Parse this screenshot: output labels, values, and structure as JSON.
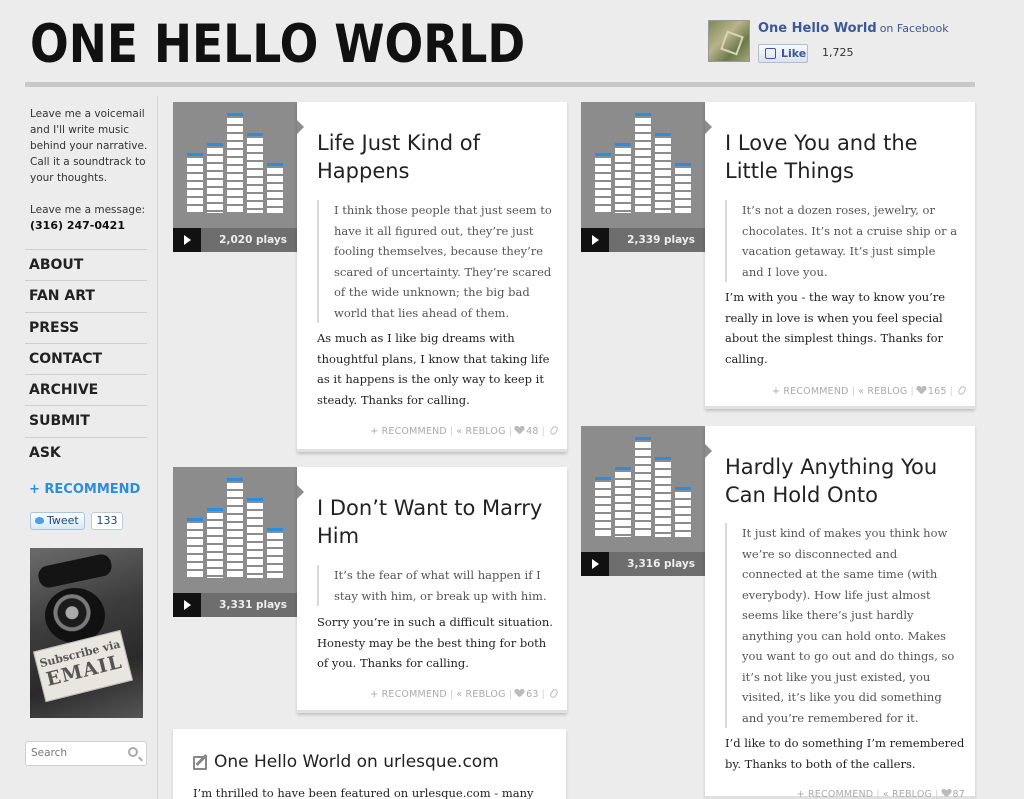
{
  "site": {
    "title": "ONE HELLO WORLD"
  },
  "facebook": {
    "page_name": "One Hello World",
    "on_text": "on Facebook",
    "like_label": "Like",
    "like_count": "1,725"
  },
  "sidebar": {
    "intro": "Leave me a voicemail and I'll write music behind your narrative. Call it a soundtrack to your thoughts.",
    "message_label": "Leave me a message:",
    "phone": "(316) 247-0421",
    "nav": [
      "About",
      "Fan Art",
      "Press",
      "Contact",
      "Archive",
      "Submit",
      "Ask"
    ],
    "recommend_label": "+ RECOMMEND",
    "tweet_label": "Tweet",
    "tweet_count": "133",
    "subscribe_line1": "Subscribe via",
    "subscribe_line2": "EMAIL",
    "search_placeholder": "Search"
  },
  "posts": [
    {
      "title": "Life Just Kind of Happens",
      "plays": "2,020 plays",
      "quote": "I think those people that just seem to have it all figured out, they’re just fooling themselves, because they’re scared of uncertainty. They’re scared of the wide unknown; the big bad world that lies ahead of them.",
      "body": "As much as I like big dreams with thoughtful plans, I know that taking life as it happens is the only way to keep it steady. Thanks for calling.",
      "recommend": "+ RECOMMEND",
      "reblog": "« REBLOG",
      "likes": "48"
    },
    {
      "title": "I Love You and the Little Things",
      "plays": "2,339 plays",
      "quote": "It’s not a dozen roses, jewelry, or chocolates. It’s not a cruise ship or a vacation getaway. It’s just simple and I love you.",
      "body": "I’m with you - the way to know you’re really in love is when you feel special about the simplest things. Thanks for calling.",
      "recommend": "+ RECOMMEND",
      "reblog": "« REBLOG",
      "likes": "165"
    },
    {
      "title": "I Don’t Want to Marry Him",
      "plays": "3,331 plays",
      "quote": "It’s the fear of what will happen if I stay with him, or break up with him.",
      "body": "Sorry you’re in such a difficult situation. Honesty may be the best thing for both of you. Thanks for calling.",
      "recommend": "+ RECOMMEND",
      "reblog": "« REBLOG",
      "likes": "63"
    },
    {
      "title": "Hardly Anything You Can Hold Onto",
      "plays": "3,316 plays",
      "quote": "It just kind of makes you think how we’re so disconnected and connected at the same time (with everybody). How life just almost seems like there’s just hardly anything you can hold onto. Makes you want to go out and do things, so it’s not like you just existed, you visited, it’s like you did something and you’re remembered for it.",
      "body": "I’d like to do something I’m remembered by. Thanks to both of the callers.",
      "recommend": "+ RECOMMEND",
      "reblog": "« REBLOG",
      "likes": "87"
    }
  ],
  "text_post": {
    "title": "One Hello World on urlesque.com",
    "body": "I’m thrilled to have been featured on urlesque.com - many"
  },
  "colors": {
    "accent": "#2b8fd8",
    "meter_cap": "#2c8de0",
    "facebook": "#3b5998"
  }
}
